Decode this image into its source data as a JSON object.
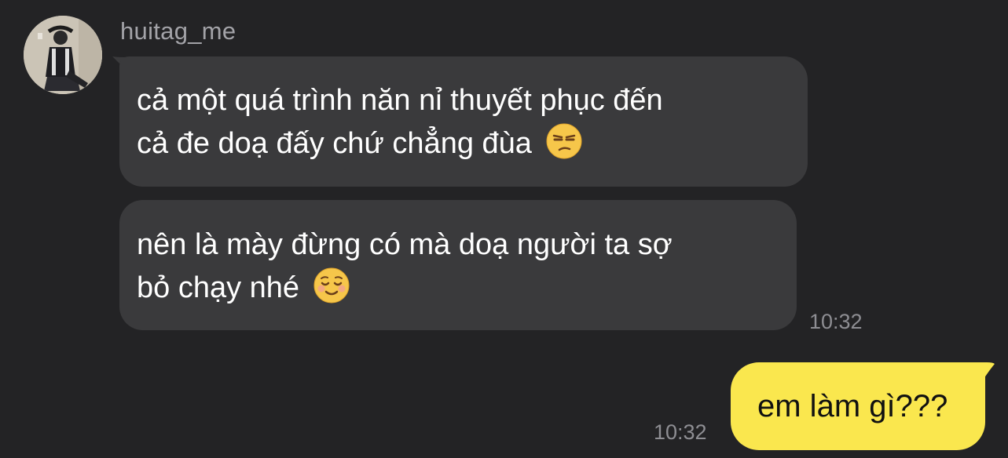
{
  "conversation": {
    "sender": "huitag_me",
    "incoming": [
      {
        "line1": "cả một quá trình năn nỉ thuyết phục đến",
        "line2": "cả đe doạ đấy chứ chẳng đùa",
        "emoji": "unamused-face-emoji"
      },
      {
        "line1": "nên là mày đừng có mà doạ người ta sợ",
        "line2": "bỏ chạy nhé",
        "emoji": "relieved-face-emoji"
      }
    ],
    "incoming_time": "10:32",
    "outgoing": {
      "text": "em làm gì???",
      "time": "10:32"
    }
  },
  "colors": {
    "background": "#232325",
    "incoming_bubble": "#3a3a3c",
    "outgoing_bubble": "#fae74e",
    "timestamp": "#8e8e93"
  }
}
